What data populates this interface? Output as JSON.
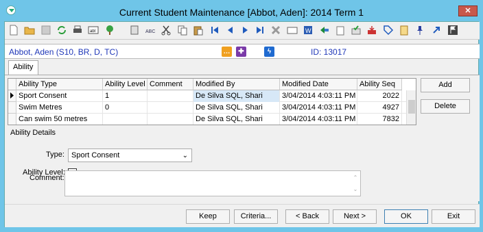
{
  "window": {
    "title": "Current Student Maintenance  [Abbot, Aden]:  2014 Term 1",
    "close_label": "✕"
  },
  "toolbar": {
    "icons": [
      "new-icon",
      "open-folder-icon",
      "save-icon",
      "refresh-icon",
      "print-icon",
      "abl-icon",
      "tree-icon",
      "calculator-icon",
      "spellcheck-icon",
      "cut-icon",
      "copy-icon",
      "paste-icon",
      "first-record-icon",
      "previous-record-icon",
      "next-record-icon",
      "last-record-icon",
      "delete-icon",
      "card-icon",
      "word-icon",
      "route-icon",
      "clipboard-icon",
      "approve-icon",
      "inbox-icon",
      "tag-icon",
      "checklist-icon",
      "pin-icon",
      "arrow-icon",
      "flag-icon"
    ]
  },
  "student": {
    "name": "Abbot, Aden (S10, BR, D, TC)",
    "id_text": "ID: 13017"
  },
  "tabs": [
    {
      "label": "Ability"
    }
  ],
  "grid": {
    "columns": [
      "Ability Type",
      "Ability Level",
      "Comment",
      "Modified By",
      "Modified Date",
      "Ability Seq"
    ],
    "rows": [
      {
        "type": "Sport Consent",
        "level": "1",
        "comment": "",
        "modified_by": "De Silva SQL, Shari",
        "modified_date": "3/04/2014 4:03:11 PM",
        "seq": "2022"
      },
      {
        "type": "Swim Metres",
        "level": "0",
        "comment": "",
        "modified_by": "De Silva SQL, Shari",
        "modified_date": "3/04/2014 4:03:11 PM",
        "seq": "4927"
      },
      {
        "type": "Can swim 50 metres",
        "level": "",
        "comment": "",
        "modified_by": "De Silva SQL, Shari",
        "modified_date": "3/04/2014 4:03:11 PM",
        "seq": "7832"
      }
    ]
  },
  "side_buttons": {
    "add": "Add",
    "delete": "Delete"
  },
  "details": {
    "heading": "Ability Details",
    "type_label": "Type:",
    "type_value": "Sport Consent",
    "level_label": "Ability Level:",
    "comment_label": "Comment:"
  },
  "footer": {
    "keep": "Keep",
    "criteria": "Criteria...",
    "back": "< Back",
    "next": "Next >",
    "ok": "OK",
    "exit": "Exit"
  }
}
